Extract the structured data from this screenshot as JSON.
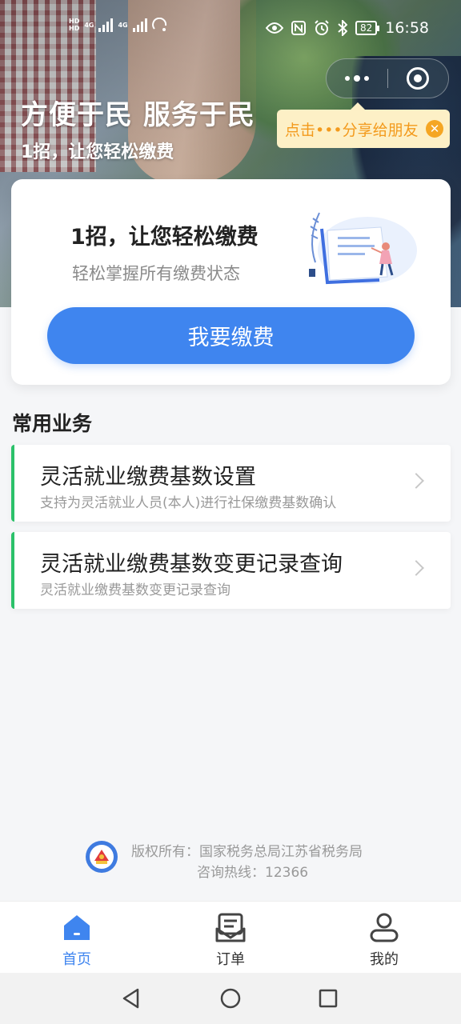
{
  "status_bar": {
    "network_top": "HD",
    "network_bottom": "HD",
    "gen1": "4G",
    "gen2": "4G",
    "battery": "82",
    "time": "16:58"
  },
  "hero": {
    "title": "方便于民 服务于民",
    "subtitle": "1招，让您轻松缴费"
  },
  "share_tip": {
    "text": "点击•••分享给朋友",
    "close_icon": "close-icon"
  },
  "pay_card": {
    "title": "1招，让您轻松缴费",
    "subtitle": "轻松掌握所有缴费状态",
    "button": "我要缴费"
  },
  "section": {
    "title": "常用业务",
    "items": [
      {
        "title": "灵活就业缴费基数设置",
        "desc": "支持为灵活就业人员(本人)进行社保缴费基数确认"
      },
      {
        "title": "灵活就业缴费基数变更记录查询",
        "desc": "灵活就业缴费基数变更记录查询"
      }
    ]
  },
  "footer": {
    "copyright": "版权所有：国家税务总局江苏省税务局",
    "hotline": "咨询热线：12366"
  },
  "tabs": [
    {
      "label": "首页",
      "icon": "home-icon",
      "active": true
    },
    {
      "label": "订单",
      "icon": "order-icon",
      "active": false
    },
    {
      "label": "我的",
      "icon": "user-icon",
      "active": false
    }
  ],
  "colors": {
    "primary": "#3f85ef",
    "accent_green": "#2bc16a",
    "tip_bg": "#fdf0c6",
    "tip_text": "#f39a1c"
  }
}
